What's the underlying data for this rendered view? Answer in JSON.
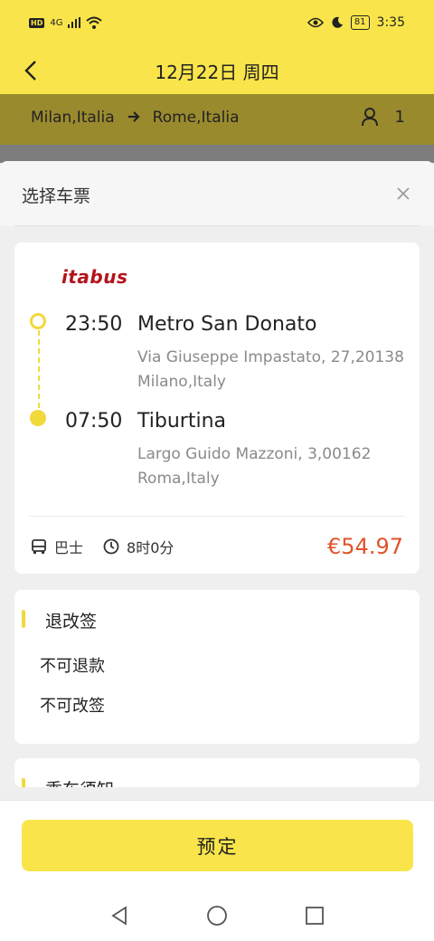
{
  "status_bar": {
    "network_badge": "HD",
    "network_type": "4G",
    "battery": "81",
    "time": "3:35"
  },
  "header": {
    "title": "12月22日 周四"
  },
  "route": {
    "from": "Milan,Italia",
    "to": "Rome,Italia",
    "passengers": "1"
  },
  "sheet": {
    "title": "选择车票"
  },
  "ticket": {
    "operator_logo": "itabus",
    "departure": {
      "time": "23:50",
      "station": "Metro San Donato",
      "address": "Via Giuseppe Impastato, 27,20138 Milano,Italy"
    },
    "arrival": {
      "time": "07:50",
      "station": "Tiburtina",
      "address": "Largo Guido Mazzoni, 3,00162 Roma,Italy"
    },
    "vehicle": "巴士",
    "duration": "8时0分",
    "price": "€54.97"
  },
  "refund_section": {
    "title": "退改签",
    "rule1": "不可退款",
    "rule2": "不可改签"
  },
  "notice_section": {
    "title": "乘车须知"
  },
  "book_button": "预定",
  "colors": {
    "brand_yellow": "#f9e54b",
    "price_orange": "#e0532b",
    "logo_red": "#b3141d"
  }
}
